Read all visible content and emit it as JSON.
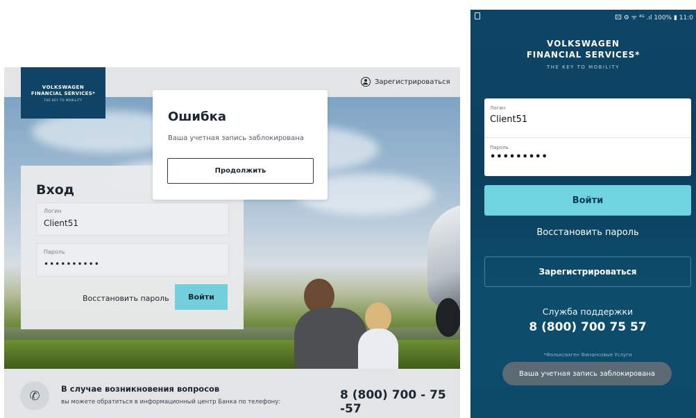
{
  "web": {
    "logo": {
      "line1": "VOLKSWAGEN",
      "line2": "FINANCIAL SERVICES*",
      "tagline": "THE KEY TO MOBILITY"
    },
    "header": {
      "register_label": "Зарегистрироваться",
      "register_icon": "user-circle-icon"
    },
    "login": {
      "title": "Вход",
      "login_label": "Логин",
      "login_value": "Client51",
      "password_label": "Пароль",
      "password_value": "••••••••••",
      "restore_label": "Восстановить пароль",
      "submit_label": "Войти",
      "accent_color": "#73cfdc"
    },
    "error_modal": {
      "title": "Ошибка",
      "message": "Ваша учетная запись заблокирована",
      "continue_label": "Продолжить"
    },
    "footer": {
      "phone_icon": "phone-icon",
      "title": "В случае возникновения вопросов",
      "subtitle": "вы можете обратиться в информационный центр Банка по телефону:",
      "phone": "8 (800) 700 - 75 -57"
    }
  },
  "mobile": {
    "status_bar": {
      "right_text": "🖾 ⚙ ᯤ ⁴ᴳ .ıl 100% ▮ 11:0"
    },
    "logo": {
      "line1": "VOLKSWAGEN",
      "line2": "FINANCIAL SERVICES*",
      "tagline": "THE KEY TO MOBILITY"
    },
    "form": {
      "login_label": "Логин",
      "login_value": "Client51",
      "password_label": "Пароль",
      "password_value": "•••••••••"
    },
    "login_button": "Войти",
    "restore_label": "Восстановить пароль",
    "register_button": "Зарегистрироваться",
    "support": {
      "title": "Служба поддержки",
      "phone": "8 (800) 700 75 57"
    },
    "foot_note": "*Фольксваген Финансовые Услуги",
    "toast": "Ваша учетная запись заблокирована",
    "colors": {
      "background": "#0e4565",
      "button": "#6fd3e0"
    }
  }
}
